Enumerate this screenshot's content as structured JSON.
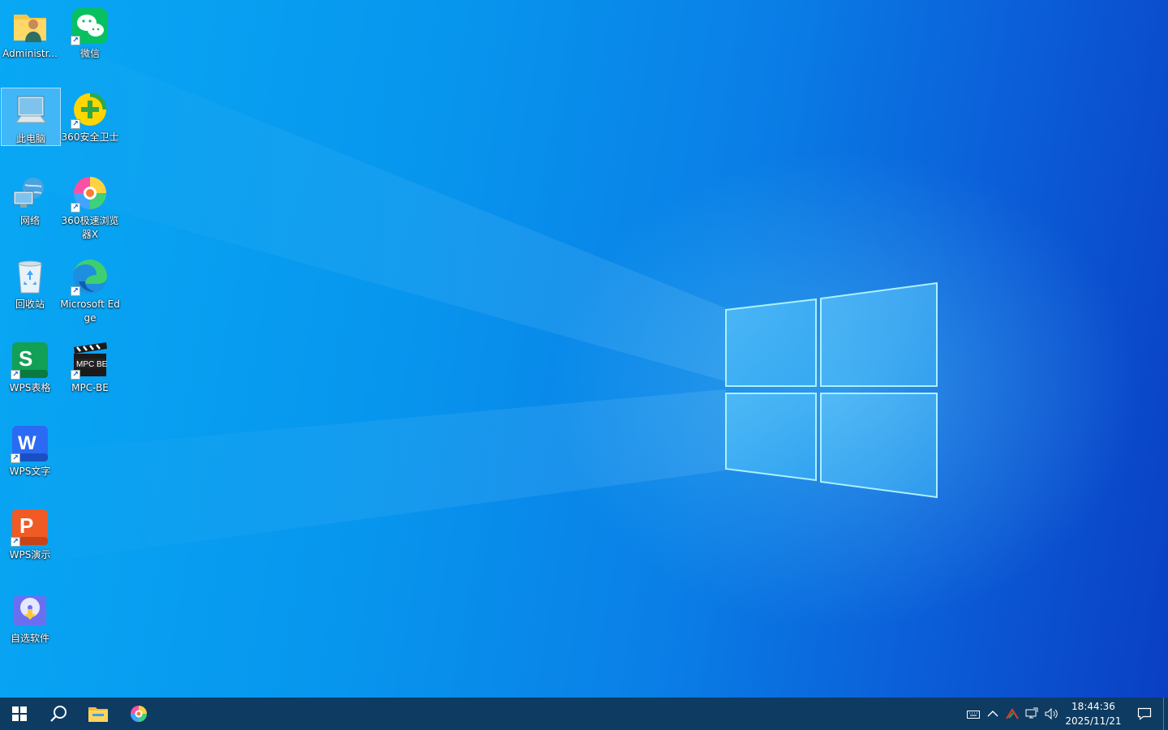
{
  "desktop": {
    "icons": [
      {
        "label": "Administr...",
        "icon": "user-folder-icon"
      },
      {
        "label": "微信",
        "icon": "wechat-icon"
      },
      {
        "label": "此电脑",
        "icon": "this-pc-icon"
      },
      {
        "label": "360安全卫士",
        "icon": "360-security-icon"
      },
      {
        "label": "网络",
        "icon": "network-icon"
      },
      {
        "label": "360极速浏览器X",
        "icon": "360-browser-icon"
      },
      {
        "label": "回收站",
        "icon": "recycle-bin-icon"
      },
      {
        "label": "Microsoft Edge",
        "icon": "edge-icon"
      },
      {
        "label": "WPS表格",
        "icon": "wps-spreadsheet-icon",
        "glyph": "S"
      },
      {
        "label": "MPC-BE",
        "icon": "mpc-be-icon",
        "glyph": "MPC BE"
      },
      {
        "label": "WPS文字",
        "icon": "wps-writer-icon",
        "glyph": "W"
      },
      {
        "label": "WPS演示",
        "icon": "wps-presentation-icon",
        "glyph": "P"
      },
      {
        "label": "自选软件",
        "icon": "software-installer-icon"
      }
    ],
    "selected_icon": "此电脑"
  },
  "taskbar": {
    "pinned": [
      "start-button",
      "search-button",
      "file-explorer",
      "360-browser"
    ],
    "tray": {
      "icons": [
        "keyboard-icon",
        "chevron-up-icon",
        "wps-tray-icon",
        "network-tray-icon",
        "volume-icon"
      ]
    },
    "clock": {
      "time": "18:44:36",
      "date": "2025/11/21"
    }
  },
  "colors": {
    "taskbar": "#0e3b61",
    "wallpaper_accent": "#0a7fe6"
  }
}
